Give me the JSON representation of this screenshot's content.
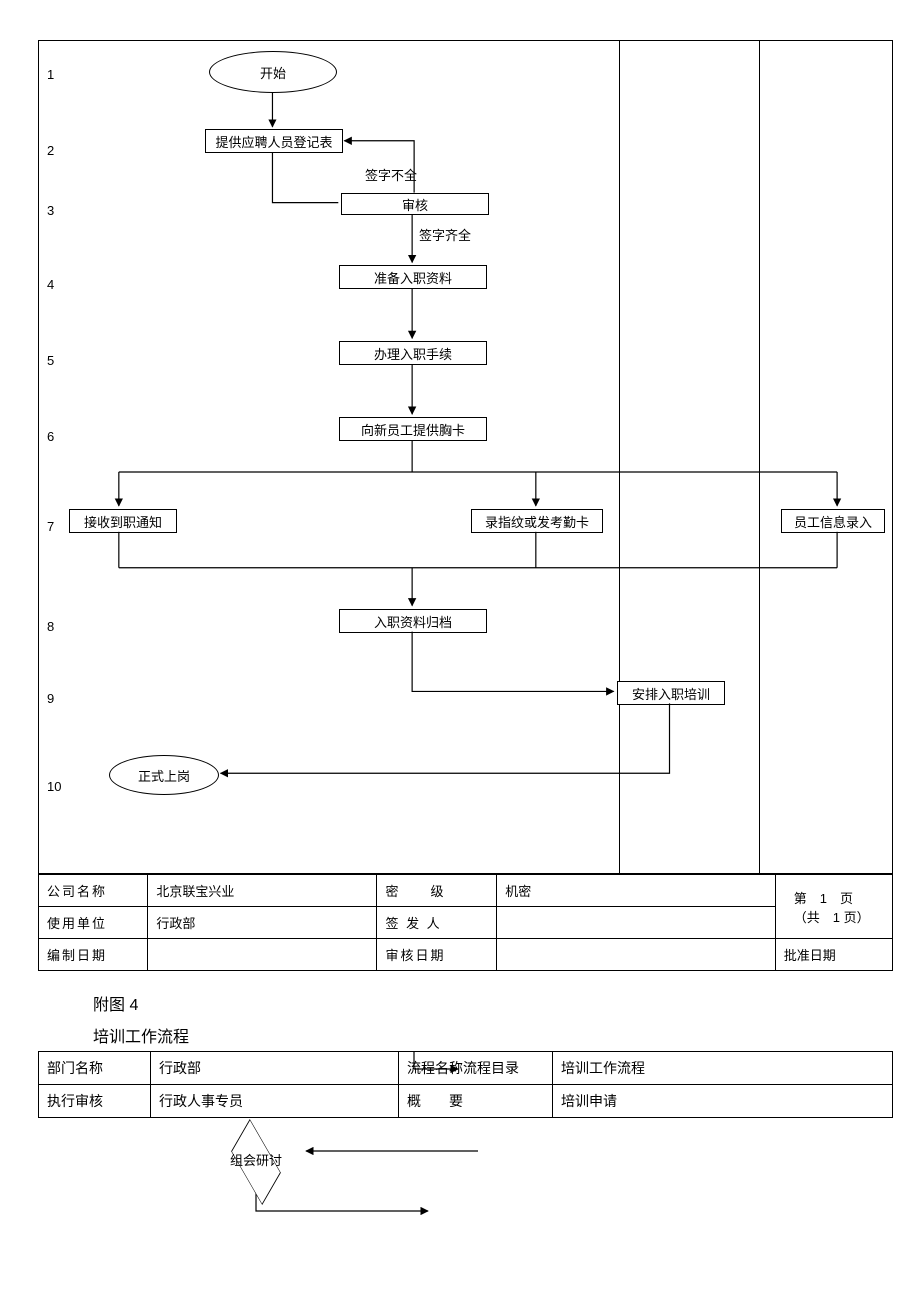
{
  "diagram": {
    "row_numbers": [
      "1",
      "2",
      "3",
      "4",
      "5",
      "6",
      "7",
      "8",
      "9",
      "10"
    ],
    "start": "开始",
    "n1": "提供应聘人员登记表",
    "audit": "审核",
    "lbl_incomplete": "签字不全",
    "lbl_complete": "签字齐全",
    "n2": "准备入职资料",
    "n3": "办理入职手续",
    "n4": "向新员工提供胸卡",
    "n5": "接收到职通知",
    "n6": "录指纹或发考勤卡",
    "n7": "员工信息录入",
    "n8": "入职资料归档",
    "n9": "安排入职培训",
    "end": "正式上岗"
  },
  "meta": {
    "company_label": "公司名称",
    "company_value": "北京联宝兴业",
    "secret_label": "密　　级",
    "secret_value": "机密",
    "page_text": "第　1　页　（共　1 页）",
    "dept_label": "使用单位",
    "dept_value": "行政部",
    "sign_label": "签 发 人",
    "compile_date_label": "编制日期",
    "review_date_label": "审核日期",
    "approve_date_label": "批准日期"
  },
  "figure": {
    "attach": "附图 4",
    "title": "培训工作流程"
  },
  "table2": {
    "dept_name_label": "部门名称",
    "dept_name_value": "行政部",
    "flow_name_label": "流程名称流程目录",
    "flow_name_value": "培训工作流程",
    "exec_label": "执行审核",
    "exec_value": "行政人事专员",
    "summary_label": "概　　要",
    "summary_value": "培训申请",
    "diamond_text": "组会研讨"
  }
}
